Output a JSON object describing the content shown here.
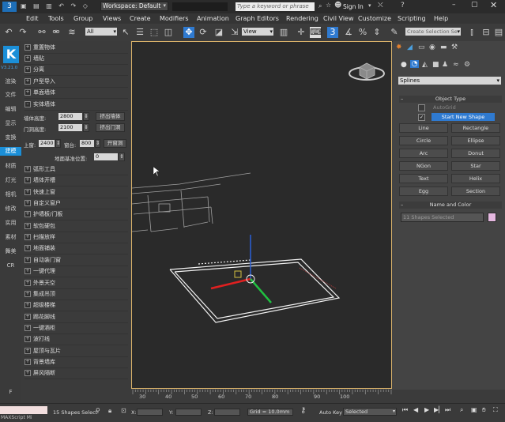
{
  "window": {
    "workspace_label": "Workspace: Default",
    "search_placeholder": "Type a keyword or phrase",
    "sign_in": "Sign In"
  },
  "menu": [
    "Edit",
    "Tools",
    "Group",
    "Views",
    "Create",
    "Modifiers",
    "Animation",
    "Graph Editors",
    "Rendering",
    "Civil View",
    "Customize",
    "Scripting",
    "Help"
  ],
  "toolbar": {
    "filter_value": "All",
    "ref_coord_value": "View",
    "selection_set_value": "Create Selection Se"
  },
  "left_nav": {
    "logo": "K",
    "version": "V3.21.0",
    "items": [
      "渲染",
      "文件",
      "编辑",
      "显示",
      "变换",
      "建模",
      "材质",
      "灯光",
      "相机",
      "修改",
      "实用",
      "素材",
      "舞美",
      "CR"
    ],
    "bottom_letter": "F"
  },
  "plugin_panel": {
    "categories_top": [
      "重置物体",
      "墙贴",
      "分离",
      "户型导入",
      "单面墙体",
      "实体墙体"
    ],
    "wall_height_label": "墙体高度:",
    "wall_height_value": "2800",
    "extrude_wall_btn": "挤出墙体",
    "door_height_label": "门洞高度:",
    "door_height_value": "2100",
    "extrude_door_btn": "挤出门洞",
    "upper_label": "上窗:",
    "upper_value": "2400",
    "sill_label": "窗台:",
    "sill_value": "800",
    "open_window_btn": "开窗洞",
    "floor_label": "地面基准位置:",
    "floor_value": "0",
    "categories_bottom": [
      "弧形工具",
      "墙体开槽",
      "快速上窗",
      "自定义窗户",
      "护墙板/门板",
      "软包硬包",
      "扫描放样",
      "地面铺装",
      "自动装门窗",
      "一键代理",
      "外景天空",
      "集成吊顶",
      "超级楼梯",
      "踢花脚线",
      "一键酒柜",
      "波打线",
      "屋顶与瓦片",
      "背景墙库",
      "屏风隔断"
    ]
  },
  "command_panel": {
    "category_dropdown": "Splines",
    "object_type_header": "Object Type",
    "autogrid_label": "AutoGrid",
    "start_new_shape_label": "Start New Shape",
    "buttons": [
      "Line",
      "Rectangle",
      "Circle",
      "Ellipse",
      "Arc",
      "Donut",
      "NGon",
      "Star",
      "Text",
      "Helix",
      "Egg",
      "Section"
    ],
    "name_color_header": "Name and Color",
    "name_field": "11 Shapes Selected",
    "swatch_color": "#e5b8e0"
  },
  "timeline": {
    "ticks": [
      "30",
      "40",
      "50",
      "60",
      "70",
      "80",
      "90",
      "100"
    ]
  },
  "status": {
    "script_label": "MAXScript Mi",
    "selection_count": "15 Shapes Select",
    "x_label": "X:",
    "y_label": "Y:",
    "z_label": "Z:",
    "grid_label": "Grid = 10.0mm",
    "autokey_label": "Auto Key",
    "selected_dropdown": "Selected"
  }
}
